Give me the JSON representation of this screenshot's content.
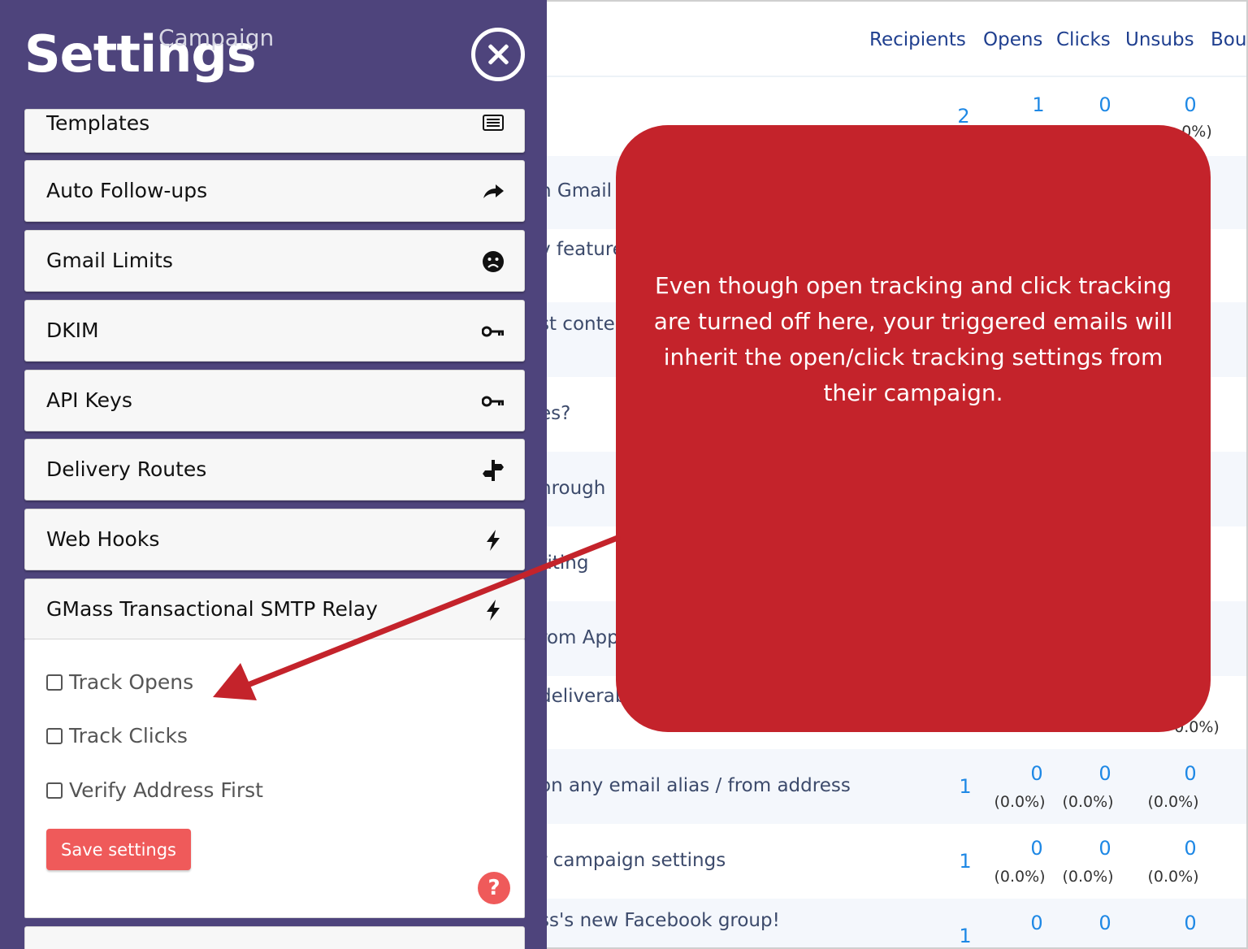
{
  "background_table": {
    "ghost_title": "Campaign",
    "columns": [
      "Recipients",
      "Opens",
      "Clicks",
      "Unsubs",
      "Bou"
    ],
    "rows": [
      {
        "subject": "",
        "recipients": "2",
        "opens": "1",
        "clicks": "0",
        "unsubs": "0",
        "opens_pct": "",
        "clicks_pct": "",
        "unsubs_pct": "0%)"
      },
      {
        "subject": "n Gmail"
      },
      {
        "subject": "v feature"
      },
      {
        "subject": "st conte"
      },
      {
        "subject": "es?"
      },
      {
        "subject": "hrough"
      },
      {
        "subject": "riting"
      },
      {
        "subject": "rom App"
      },
      {
        "subject": "deliverab",
        "unsubs_pct": "0.0%)"
      },
      {
        "subject": "on any email alias / from address",
        "recipients": "1",
        "opens": "0",
        "clicks": "0",
        "unsubs": "0",
        "opens_pct": "(0.0%)",
        "clicks_pct": "(0.0%)",
        "unsubs_pct": "(0.0%)"
      },
      {
        "subject": "r campaign settings",
        "recipients": "1",
        "opens": "0",
        "clicks": "0",
        "unsubs": "0",
        "opens_pct": "(0.0%)",
        "clicks_pct": "(0.0%)",
        "unsubs_pct": "(0.0%)"
      },
      {
        "subject": "ss's new Facebook group!",
        "recipients": "1",
        "opens": "0",
        "clicks": "0",
        "unsubs": "0"
      }
    ]
  },
  "settings_panel": {
    "title": "Settings",
    "menu_items": [
      {
        "label": "Templates",
        "icon": "list-icon"
      },
      {
        "label": "Auto Follow-ups",
        "icon": "share-arrow-icon"
      },
      {
        "label": "Gmail Limits",
        "icon": "sad-face-icon"
      },
      {
        "label": "DKIM",
        "icon": "key-icon"
      },
      {
        "label": "API Keys",
        "icon": "key-icon"
      },
      {
        "label": "Delivery Routes",
        "icon": "signpost-icon"
      },
      {
        "label": "Web Hooks",
        "icon": "bolt-icon"
      },
      {
        "label": "GMass Transactional SMTP Relay",
        "icon": "bolt-icon"
      }
    ],
    "options": {
      "track_opens": {
        "label": "Track Opens",
        "checked": false
      },
      "track_clicks": {
        "label": "Track Clicks",
        "checked": false
      },
      "verify_address": {
        "label": "Verify Address First",
        "checked": false
      }
    },
    "save_label": "Save settings",
    "help_label": "?"
  },
  "callout": {
    "text": "Even though open tracking and click tracking are turned off here, your triggered emails will inherit the open/click tracking settings from their campaign."
  },
  "colors": {
    "panel_bg": "#4e447c",
    "callout_bg": "#c4232b",
    "arrow": "#c4232b",
    "accent_blue": "#1e88e5",
    "save_btn": "#ef5a5a"
  }
}
